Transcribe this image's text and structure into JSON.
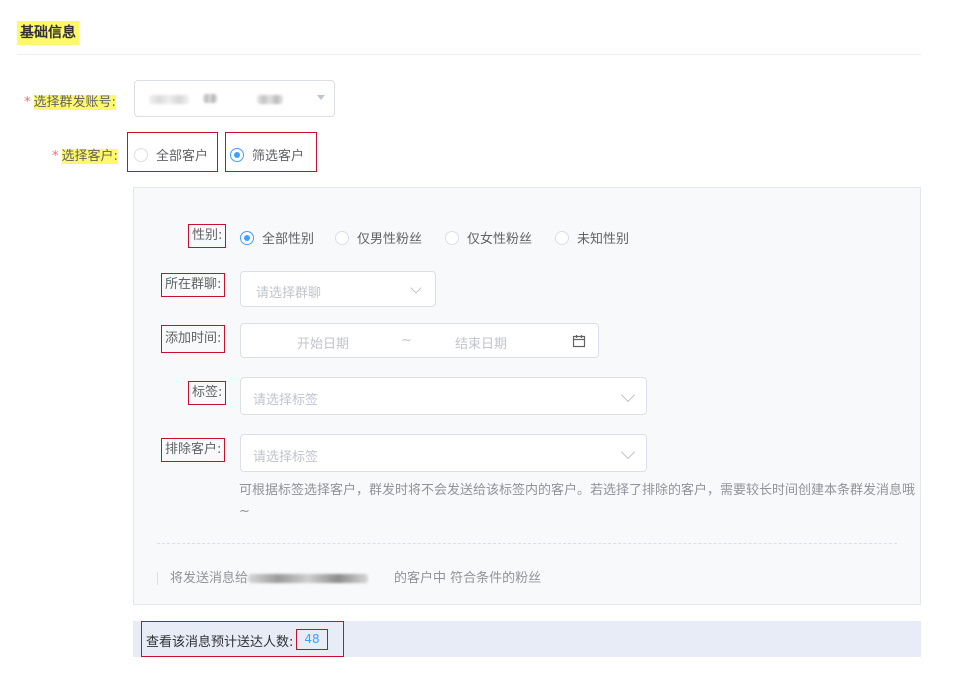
{
  "section": {
    "title": "基础信息"
  },
  "account": {
    "label": "选择群发账号:",
    "required": "*"
  },
  "customers": {
    "label": "选择客户:",
    "required": "*",
    "options": [
      {
        "label": "全部客户",
        "checked": false
      },
      {
        "label": "筛选客户",
        "checked": true
      }
    ]
  },
  "filter": {
    "gender": {
      "label": "性别:",
      "options": [
        {
          "label": "全部性别",
          "checked": true
        },
        {
          "label": "仅男性粉丝",
          "checked": false
        },
        {
          "label": "仅女性粉丝",
          "checked": false
        },
        {
          "label": "未知性别",
          "checked": false
        }
      ]
    },
    "group_chat": {
      "label": "所在群聊:",
      "placeholder": "请选择群聊"
    },
    "add_time": {
      "label": "添加时间:",
      "start_placeholder": "开始日期",
      "separator": "~",
      "end_placeholder": "结束日期"
    },
    "tags": {
      "label": "标签:",
      "placeholder": "请选择标签"
    },
    "exclude": {
      "label": "排除客户:",
      "placeholder": "请选择标签"
    },
    "hint": "可根据标签选择客户，群发时将不会发送给该标签内的客户。若选择了排除的客户，需要较长时间创建本条群发消息哦~",
    "summary_prefix": "将发送消息给",
    "summary_suffix": "的客户中 符合条件的粉丝"
  },
  "estimate": {
    "label": "查看该消息预计送达人数:",
    "value": "48"
  },
  "colors": {
    "accent": "#409eff",
    "highlight": "#fff86a",
    "annotation_box": "#c8102e",
    "required": "#f56c6c"
  }
}
